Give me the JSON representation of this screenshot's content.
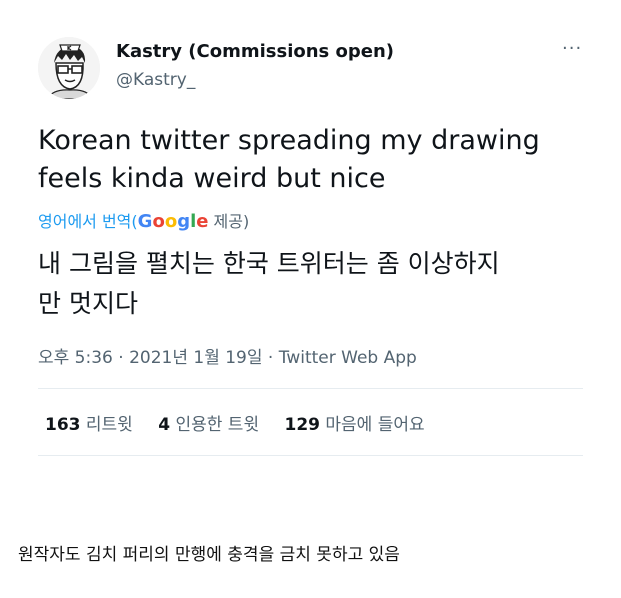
{
  "tweet": {
    "author": {
      "display_name": "Kastry (Commissions open)",
      "handle": "@Kastry_",
      "avatar_icon": "cartoon-avatar-icon"
    },
    "more_icon": "more-options-icon",
    "more_glyph": "···",
    "text_line1": "Korean twitter spreading my drawing",
    "text_line2": "feels kinda weird but nice",
    "translate": {
      "label": "영어에서 번역(",
      "google_G": "G",
      "google_o1": "o",
      "google_o2": "o",
      "google_g": "g",
      "google_l": "l",
      "google_e": "e",
      "suffix": " 제공)"
    },
    "translated_line1": "내 그림을 펼치는 한국 트위터는 좀 이상하지",
    "translated_line2": "만 멋지다",
    "meta": {
      "time": "오후 5:36",
      "sep1": " · ",
      "date": "2021년 1월 19일",
      "sep2": " · ",
      "source": "Twitter Web App"
    },
    "stats": {
      "retweets_count": "163",
      "retweets_label": "리트윗",
      "quotes_count": "4",
      "quotes_label": "인용한 트윗",
      "likes_count": "129",
      "likes_label": "마음에 들어요"
    }
  },
  "caption": "원작자도 김치 퍼리의 만행에 충격을 금치 못하고 있음",
  "colors": {
    "text": "#0f1419",
    "secondary": "#536471",
    "link": "#1d9bf0",
    "divider": "#e6ecf0"
  }
}
